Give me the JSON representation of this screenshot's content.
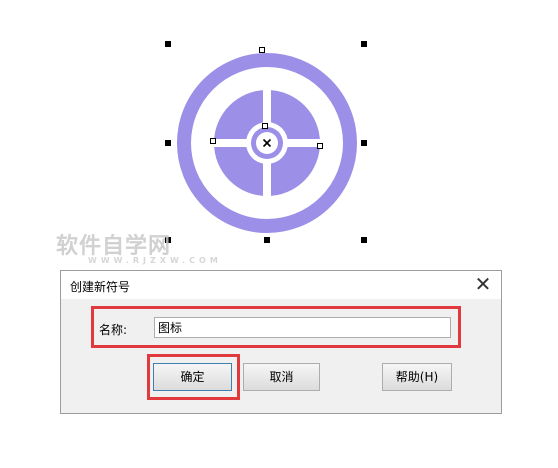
{
  "watermark": {
    "main": "软件自学网",
    "sub": "WWW.RJZXW.COM"
  },
  "dialog": {
    "title": "创建新符号",
    "close_glyph": "✕",
    "name_label": "名称:",
    "name_value": "图标",
    "ok_label": "确定",
    "cancel_label": "取消",
    "help_label": "帮助(H)"
  },
  "colors": {
    "accent": "#9b8fe8",
    "highlight": "#e0393e"
  },
  "icons": [
    "close-icon",
    "center-x-icon"
  ]
}
